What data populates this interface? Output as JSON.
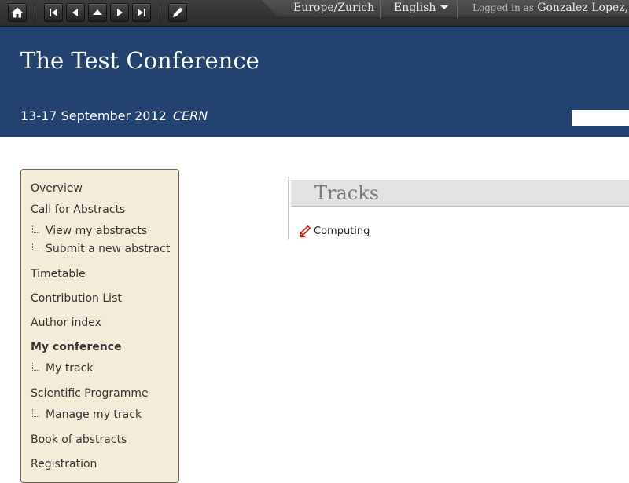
{
  "toolbar": {
    "buttons": [
      {
        "name": "home-icon"
      },
      {
        "name": "first-icon"
      },
      {
        "name": "previous-icon"
      },
      {
        "name": "up-icon"
      },
      {
        "name": "next-icon"
      },
      {
        "name": "last-icon"
      },
      {
        "name": "edit-icon"
      }
    ],
    "timezone": "Europe/Zurich",
    "language": "English",
    "logged_in_label": "Logged in as",
    "user_name": "Gonzalez Lopez, J."
  },
  "header": {
    "title": "The Test Conference",
    "date": "13-17 September 2012",
    "venue": "CERN",
    "color": "#23426f"
  },
  "sidebar": {
    "items": [
      {
        "label": "Overview"
      },
      {
        "label": "Call for Abstracts"
      },
      {
        "label": "View my abstracts",
        "sub": true
      },
      {
        "label": "Submit a new abstract",
        "sub": true
      },
      {
        "label": "Timetable"
      },
      {
        "label": "Contribution List"
      },
      {
        "label": "Author index"
      },
      {
        "label": "My conference",
        "selected": true
      },
      {
        "label": "My track",
        "sub": true
      },
      {
        "label": "Scientific Programme"
      },
      {
        "label": "Manage my track",
        "sub": true
      },
      {
        "label": "Book of abstracts"
      },
      {
        "label": "Registration"
      }
    ]
  },
  "main": {
    "title": "Tracks",
    "tracks": [
      {
        "label": "Computing",
        "icon": "edit-pencil-icon"
      }
    ]
  }
}
